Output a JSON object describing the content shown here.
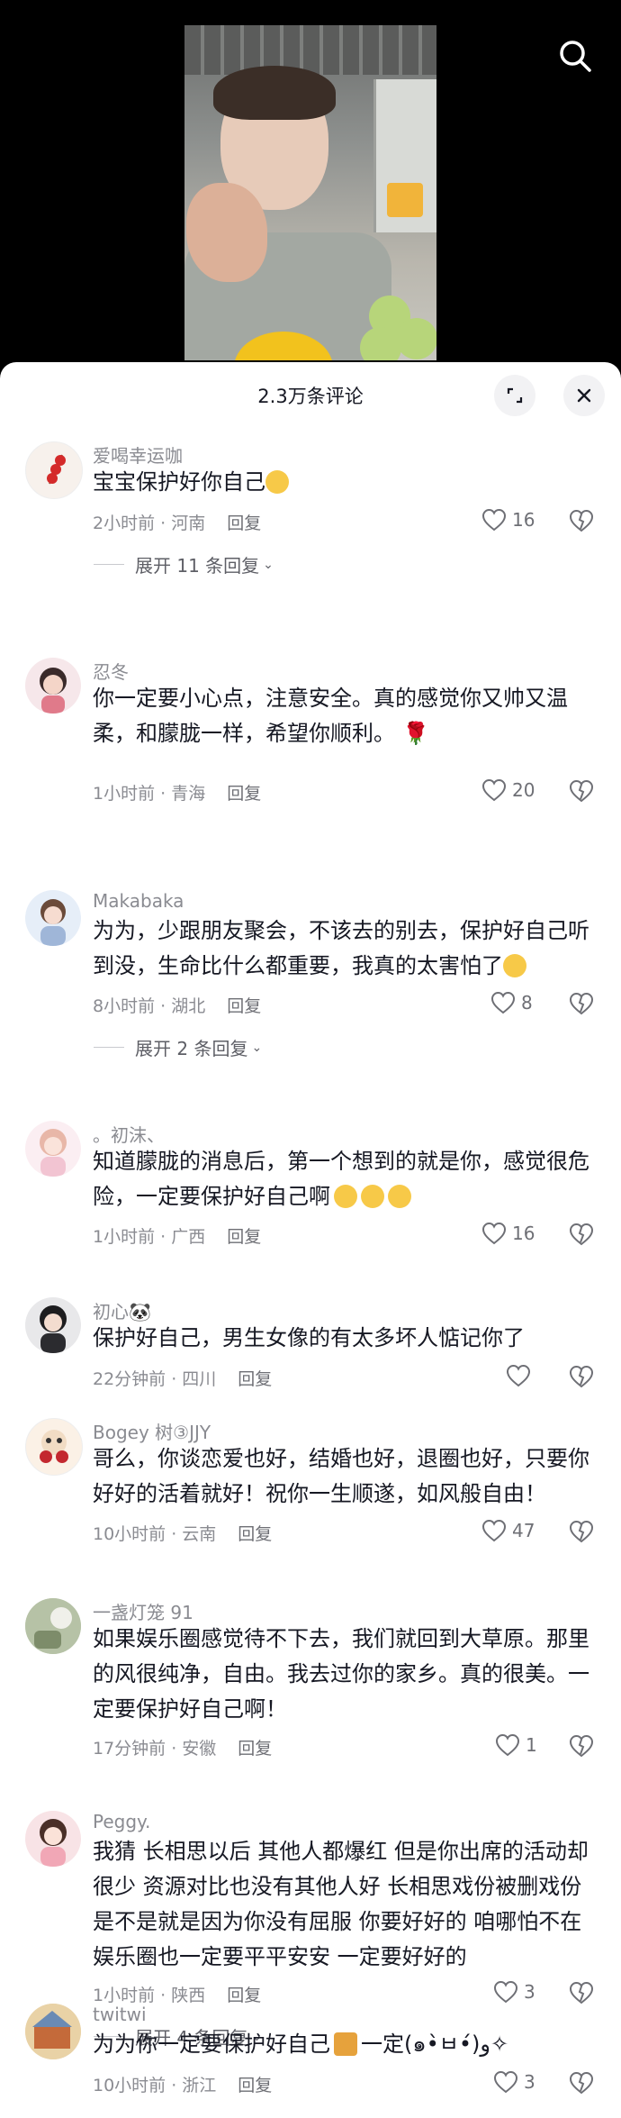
{
  "panel": {
    "title": "2.3万条评论"
  },
  "comments": [
    {
      "user": "爱喝幸运咖",
      "text": "宝宝保护好你自己",
      "time": "2小时前 · 河南",
      "reply": "回复",
      "likes": "16",
      "expand": "展开 11 条回复"
    },
    {
      "user": "忍冬",
      "text": "你一定要小心点，注意安全。真的感觉你又帅又温柔，和朦胧一样，希望你顺利。",
      "time": "1小时前 · 青海",
      "reply": "回复",
      "likes": "20"
    },
    {
      "user": "Makabaka",
      "text": "为为，少跟朋友聚会，不该去的别去，保护好自己听到没，生命比什么都重要，我真的太害怕了",
      "time": "8小时前 · 湖北",
      "reply": "回复",
      "likes": "8",
      "expand": "展开 2 条回复"
    },
    {
      "user": "。初沫、",
      "text": "知道朦胧的消息后，第一个想到的就是你，感觉很危险，一定要保护好自己啊",
      "time": "1小时前 · 广西",
      "reply": "回复",
      "likes": "16"
    },
    {
      "user": "初心🐼",
      "text": "保护好自己，男生女像的有太多坏人惦记你了",
      "time": "22分钟前 · 四川",
      "reply": "回复",
      "likes": ""
    },
    {
      "user": "Bogey 树③JJY",
      "text": "哥么，你谈恋爱也好，结婚也好，退圈也好，只要你好好的活着就好！祝你一生顺遂，如风般自由！",
      "time": "10小时前 · 云南",
      "reply": "回复",
      "likes": "47"
    },
    {
      "user": "一盏灯笼 91",
      "text": "如果娱乐圈感觉待不下去，我们就回到大草原。那里的风很纯净，自由。我去过你的家乡。真的很美。一定要保护好自己啊！",
      "time": "17分钟前 · 安徽",
      "reply": "回复",
      "likes": "1"
    },
    {
      "user": "Peggy.",
      "text": "我猜 长相思以后 其他人都爆红 但是你出席的活动却很少 资源对比也没有其他人好 长相思戏份被删戏份 是不是就是因为你没有屈服 你要好好的 咱哪怕不在娱乐圈也一定要平平安安 一定要好好的",
      "time": "1小时前 · 陕西",
      "reply": "回复",
      "likes": "3",
      "expand": "展开 4 条回复"
    },
    {
      "user": "twitwi",
      "text": "为为你一定要保护好自己",
      "text2": "一定(๑•̀ㅂ•́)و✧",
      "time": "10小时前 · 浙江",
      "reply": "回复",
      "likes": "3"
    }
  ]
}
